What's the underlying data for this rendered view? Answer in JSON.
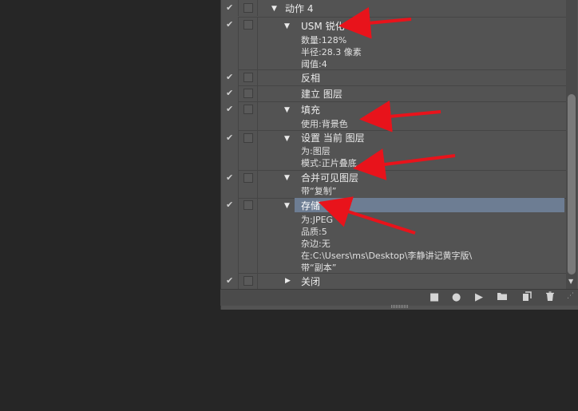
{
  "actions": {
    "rows": [
      {
        "label": "动作 4"
      },
      {
        "label": "USM 锐化",
        "params": [
          "数量:128%",
          "半径:28.3 像素",
          "阈值:4"
        ]
      },
      {
        "label": "反相"
      },
      {
        "label": "建立 图层"
      },
      {
        "label": "填充",
        "params": [
          "使用:背景色"
        ]
      },
      {
        "label": "设置 当前 图层",
        "params": [
          "为:图层",
          "模式:正片叠底"
        ]
      },
      {
        "label": "合并可见图层",
        "params": [
          "带“复制”"
        ]
      },
      {
        "label": "存储",
        "params": [
          "为:JPEG",
          "品质:5",
          "杂边:无",
          "在:C:\\Users\\ms\\Desktop\\李静讲记黄字版\\",
          "带“副本”"
        ]
      },
      {
        "label": "关闭"
      }
    ]
  },
  "toolbar": [
    "stop-icon",
    "record-icon",
    "play-icon",
    "folder-icon",
    "new-action-icon",
    "trash-icon"
  ],
  "annotation_color": "#e8131b",
  "selection_color": "#6d7d93"
}
